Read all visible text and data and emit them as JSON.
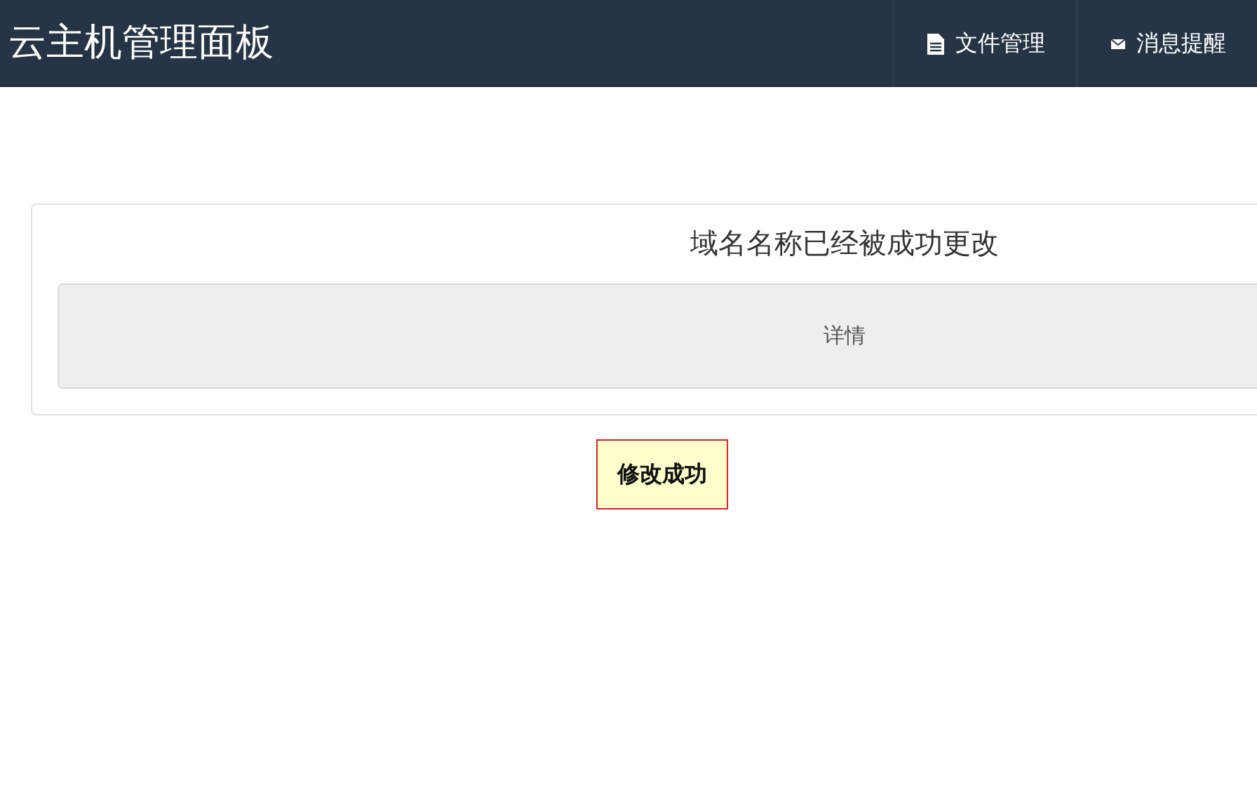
{
  "navbar": {
    "brand": "云主机管理面板",
    "items": [
      {
        "label": "文件管理",
        "kind": "file"
      },
      {
        "label": "消息提醒",
        "kind": "mail"
      }
    ]
  },
  "panel": {
    "title": "域名名称已经被成功更改",
    "details": "详情"
  },
  "toast": {
    "text": "修改成功"
  }
}
